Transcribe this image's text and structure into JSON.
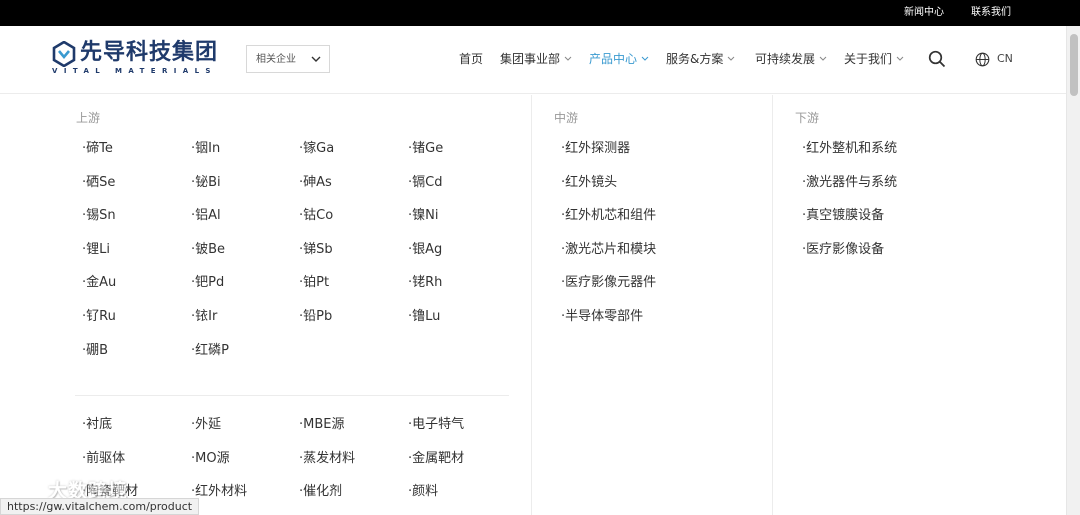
{
  "topbar": {
    "news": "新闻中心",
    "contact": "联系我们"
  },
  "logo": {
    "cn": "先导科技集团",
    "en": "VITAL MATERIALS",
    "mark_text": "VITAL"
  },
  "company_select": {
    "value": "相关企业"
  },
  "nav": [
    {
      "label": "首页",
      "dropdown": false,
      "active": false
    },
    {
      "label": "集团事业部",
      "dropdown": true,
      "active": false
    },
    {
      "label": "产品中心",
      "dropdown": true,
      "active": true
    },
    {
      "label": "服务&方案",
      "dropdown": true,
      "active": false
    },
    {
      "label": "可持续发展",
      "dropdown": true,
      "active": false
    },
    {
      "label": "关于我们",
      "dropdown": true,
      "active": false
    }
  ],
  "lang": "CN",
  "menu": {
    "upstream": {
      "title": "上游",
      "elements": [
        "·碲Te",
        "·铟In",
        "·镓Ga",
        "·锗Ge",
        "·硒Se",
        "·铋Bi",
        "·砷As",
        "·镉Cd",
        "·锡Sn",
        "·铝Al",
        "·钴Co",
        "·镍Ni",
        "·锂Li",
        "·铍Be",
        "·锑Sb",
        "·银Ag",
        "·金Au",
        "·钯Pd",
        "·铂Pt",
        "·铑Rh",
        "·钌Ru",
        "·铱Ir",
        "·铅Pb",
        "·镥Lu",
        "·硼B",
        "·红磷P"
      ],
      "materials": [
        "·衬底",
        "·外延",
        "·MBE源",
        "·电子特气",
        "·前驱体",
        "·MO源",
        "·蒸发材料",
        "·金属靶材",
        "·陶瓷靶材",
        "·红外材料",
        "·催化剂",
        "·颜料"
      ]
    },
    "midstream": {
      "title": "中游",
      "items": [
        "·红外探测器",
        "·红外镜头",
        "·红外机芯和组件",
        "·激光芯片和模块",
        "·医疗影像元器件",
        "·半导体零部件"
      ]
    },
    "downstream": {
      "title": "下游",
      "items": [
        "·红外整机和系统",
        "·激光器件与系统",
        "·真空镀膜设备",
        "·医疗影像设备"
      ]
    }
  },
  "status_url": "https://gw.vitalchem.com/product",
  "watermark": {
    "text": "大数跨境"
  },
  "colors": {
    "accent": "#3a9ad0",
    "brand": "#1f3a6b",
    "topbar": "#000000"
  }
}
